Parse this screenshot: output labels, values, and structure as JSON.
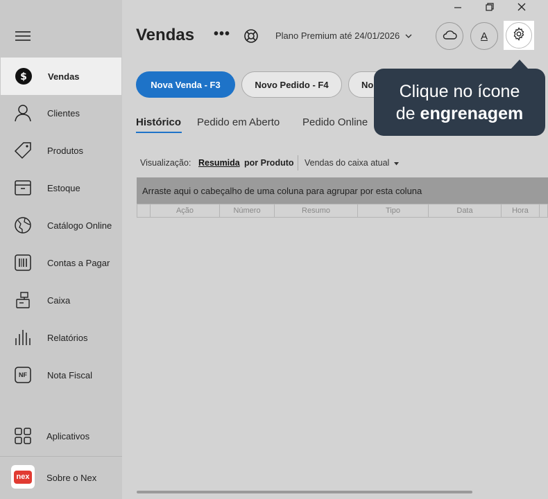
{
  "window": {
    "minimize_icon": "minimize-icon",
    "restore_icon": "restore-icon",
    "close_icon": "close-icon"
  },
  "sidebar": {
    "menu_icon": "hamburger-icon",
    "items": [
      {
        "label": "Vendas",
        "icon": "dollar-circle-icon",
        "active": true
      },
      {
        "label": "Clientes",
        "icon": "person-icon"
      },
      {
        "label": "Produtos",
        "icon": "tag-icon"
      },
      {
        "label": "Estoque",
        "icon": "box-icon"
      },
      {
        "label": "Catálogo Online",
        "icon": "globe-icon"
      },
      {
        "label": "Contas a Pagar",
        "icon": "barcode-icon"
      },
      {
        "label": "Caixa",
        "icon": "cash-register-icon"
      },
      {
        "label": "Relatórios",
        "icon": "bars-icon"
      },
      {
        "label": "Nota Fiscal",
        "icon": "nf-icon",
        "icon_text": "NF"
      }
    ],
    "apps": {
      "label": "Aplicativos",
      "icon": "grid-icon"
    },
    "about": {
      "label": "Sobre o Nex",
      "logo_text": "nex"
    }
  },
  "header": {
    "title": "Vendas",
    "more": "•••",
    "plan": "Plano Premium até 24/01/2026",
    "font_button": "A"
  },
  "actions": {
    "nova_venda": "Nova Venda - F3",
    "novo_pedido": "Novo Pedido - F4",
    "third": "No"
  },
  "tabs": [
    "Histórico",
    "Pedido em Aberto",
    "Pedido Online"
  ],
  "view": {
    "label": "Visualização:",
    "resumida": "Resumida",
    "por_produto": "por Produto",
    "filter": "Vendas do caixa atual"
  },
  "grid": {
    "group_hint": "Arraste aqui o cabeçalho de uma coluna para agrupar por esta coluna",
    "columns": [
      "Ação",
      "Número",
      "Resumo",
      "Tipo",
      "Data",
      "Hora"
    ]
  },
  "tooltip": {
    "line1": "Clique no ícone",
    "line2_prefix": "de",
    "line2_bold": "engrenagem"
  },
  "colors": {
    "primary": "#1e73c8",
    "tooltip_bg": "#2e3b4a",
    "sidebar_bg": "#c9c9c9",
    "brand_red": "#e13b32"
  }
}
